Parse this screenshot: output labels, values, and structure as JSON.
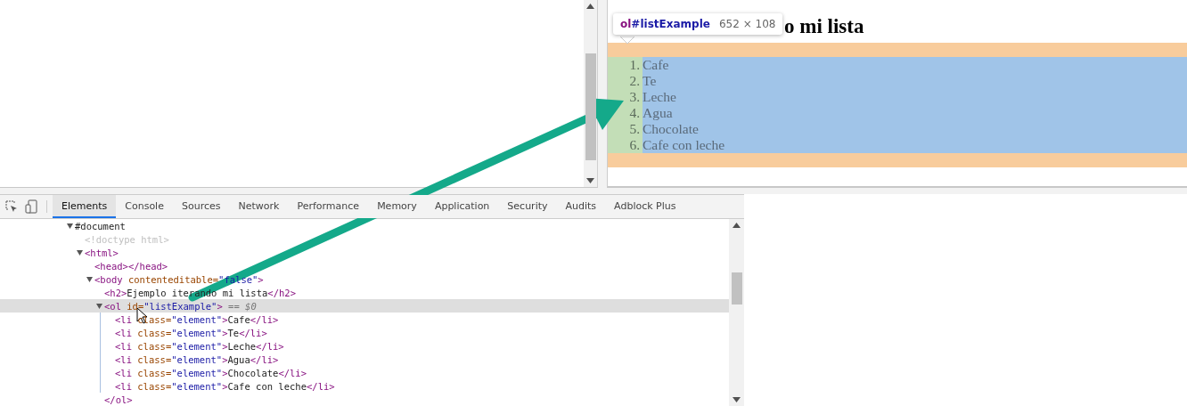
{
  "page_preview": {
    "heading": "o mi lista",
    "list_items": [
      {
        "number": "1.",
        "text": "Cafe"
      },
      {
        "number": "2.",
        "text": "Te"
      },
      {
        "number": "3.",
        "text": "Leche"
      },
      {
        "number": "4.",
        "text": "Agua"
      },
      {
        "number": "5.",
        "text": "Chocolate"
      },
      {
        "number": "6.",
        "text": "Cafe con leche"
      }
    ]
  },
  "inspect_tooltip": {
    "tag": "ol",
    "id": "#listExample",
    "size": "652 × 108"
  },
  "devtools": {
    "tabs": [
      {
        "label": "Elements",
        "selected": true
      },
      {
        "label": "Console",
        "selected": false
      },
      {
        "label": "Sources",
        "selected": false
      },
      {
        "label": "Network",
        "selected": false
      },
      {
        "label": "Performance",
        "selected": false
      },
      {
        "label": "Memory",
        "selected": false
      },
      {
        "label": "Application",
        "selected": false
      },
      {
        "label": "Security",
        "selected": false
      },
      {
        "label": "Audits",
        "selected": false
      },
      {
        "label": "Adblock Plus",
        "selected": false
      }
    ],
    "dom_tree": [
      {
        "selected": false,
        "expanded": true,
        "parts": [
          {
            "kind": "text",
            "text": "#document"
          }
        ],
        "children": [
          {
            "selected": false,
            "parts": [
              {
                "kind": "doctype",
                "text": "<!doctype html>"
              }
            ]
          },
          {
            "selected": false,
            "expanded": true,
            "parts": [
              {
                "kind": "tag",
                "text": "<html>"
              }
            ],
            "children": [
              {
                "selected": false,
                "parts": [
                  {
                    "kind": "tag",
                    "text": "<head></head>"
                  }
                ]
              },
              {
                "selected": false,
                "expanded": true,
                "parts": [
                  {
                    "kind": "tag",
                    "text": "<body "
                  },
                  {
                    "kind": "attr",
                    "text": "contenteditable="
                  },
                  {
                    "kind": "value",
                    "text": "\"false\""
                  },
                  {
                    "kind": "tag",
                    "text": ">"
                  }
                ],
                "children": [
                  {
                    "selected": false,
                    "parts": [
                      {
                        "kind": "tag",
                        "text": "<h2>"
                      },
                      {
                        "kind": "text",
                        "text": "Ejemplo iterando mi lista"
                      },
                      {
                        "kind": "tag",
                        "text": "</h2>"
                      }
                    ]
                  },
                  {
                    "selected": true,
                    "expanded": true,
                    "parts": [
                      {
                        "kind": "tag",
                        "text": "<ol "
                      },
                      {
                        "kind": "attr",
                        "text": "id="
                      },
                      {
                        "kind": "value",
                        "text": "\"listExample\""
                      },
                      {
                        "kind": "tag",
                        "text": ">"
                      },
                      {
                        "kind": "hint",
                        "text": " == $0"
                      }
                    ],
                    "close": [
                      {
                        "kind": "tag",
                        "text": "</ol>"
                      }
                    ],
                    "children": [
                      {
                        "selected": false,
                        "parts": [
                          {
                            "kind": "tag",
                            "text": "<li "
                          },
                          {
                            "kind": "attr",
                            "text": "class="
                          },
                          {
                            "kind": "value",
                            "text": "\"element\""
                          },
                          {
                            "kind": "tag",
                            "text": ">"
                          },
                          {
                            "kind": "text",
                            "text": "Cafe"
                          },
                          {
                            "kind": "tag",
                            "text": "</li>"
                          }
                        ]
                      },
                      {
                        "selected": false,
                        "parts": [
                          {
                            "kind": "tag",
                            "text": "<li "
                          },
                          {
                            "kind": "attr",
                            "text": "class="
                          },
                          {
                            "kind": "value",
                            "text": "\"element\""
                          },
                          {
                            "kind": "tag",
                            "text": ">"
                          },
                          {
                            "kind": "text",
                            "text": "Te"
                          },
                          {
                            "kind": "tag",
                            "text": "</li>"
                          }
                        ]
                      },
                      {
                        "selected": false,
                        "parts": [
                          {
                            "kind": "tag",
                            "text": "<li "
                          },
                          {
                            "kind": "attr",
                            "text": "class="
                          },
                          {
                            "kind": "value",
                            "text": "\"element\""
                          },
                          {
                            "kind": "tag",
                            "text": ">"
                          },
                          {
                            "kind": "text",
                            "text": "Leche"
                          },
                          {
                            "kind": "tag",
                            "text": "</li>"
                          }
                        ]
                      },
                      {
                        "selected": false,
                        "parts": [
                          {
                            "kind": "tag",
                            "text": "<li "
                          },
                          {
                            "kind": "attr",
                            "text": "class="
                          },
                          {
                            "kind": "value",
                            "text": "\"element\""
                          },
                          {
                            "kind": "tag",
                            "text": ">"
                          },
                          {
                            "kind": "text",
                            "text": "Agua"
                          },
                          {
                            "kind": "tag",
                            "text": "</li>"
                          }
                        ]
                      },
                      {
                        "selected": false,
                        "parts": [
                          {
                            "kind": "tag",
                            "text": "<li "
                          },
                          {
                            "kind": "attr",
                            "text": "class="
                          },
                          {
                            "kind": "value",
                            "text": "\"element\""
                          },
                          {
                            "kind": "tag",
                            "text": ">"
                          },
                          {
                            "kind": "text",
                            "text": "Chocolate"
                          },
                          {
                            "kind": "tag",
                            "text": "</li>"
                          }
                        ]
                      },
                      {
                        "selected": false,
                        "parts": [
                          {
                            "kind": "tag",
                            "text": "<li "
                          },
                          {
                            "kind": "attr",
                            "text": "class="
                          },
                          {
                            "kind": "value",
                            "text": "\"element\""
                          },
                          {
                            "kind": "tag",
                            "text": ">"
                          },
                          {
                            "kind": "text",
                            "text": "Cafe con leche"
                          },
                          {
                            "kind": "tag",
                            "text": "</li>"
                          }
                        ]
                      }
                    ]
                  }
                ]
              }
            ]
          }
        ]
      }
    ]
  }
}
